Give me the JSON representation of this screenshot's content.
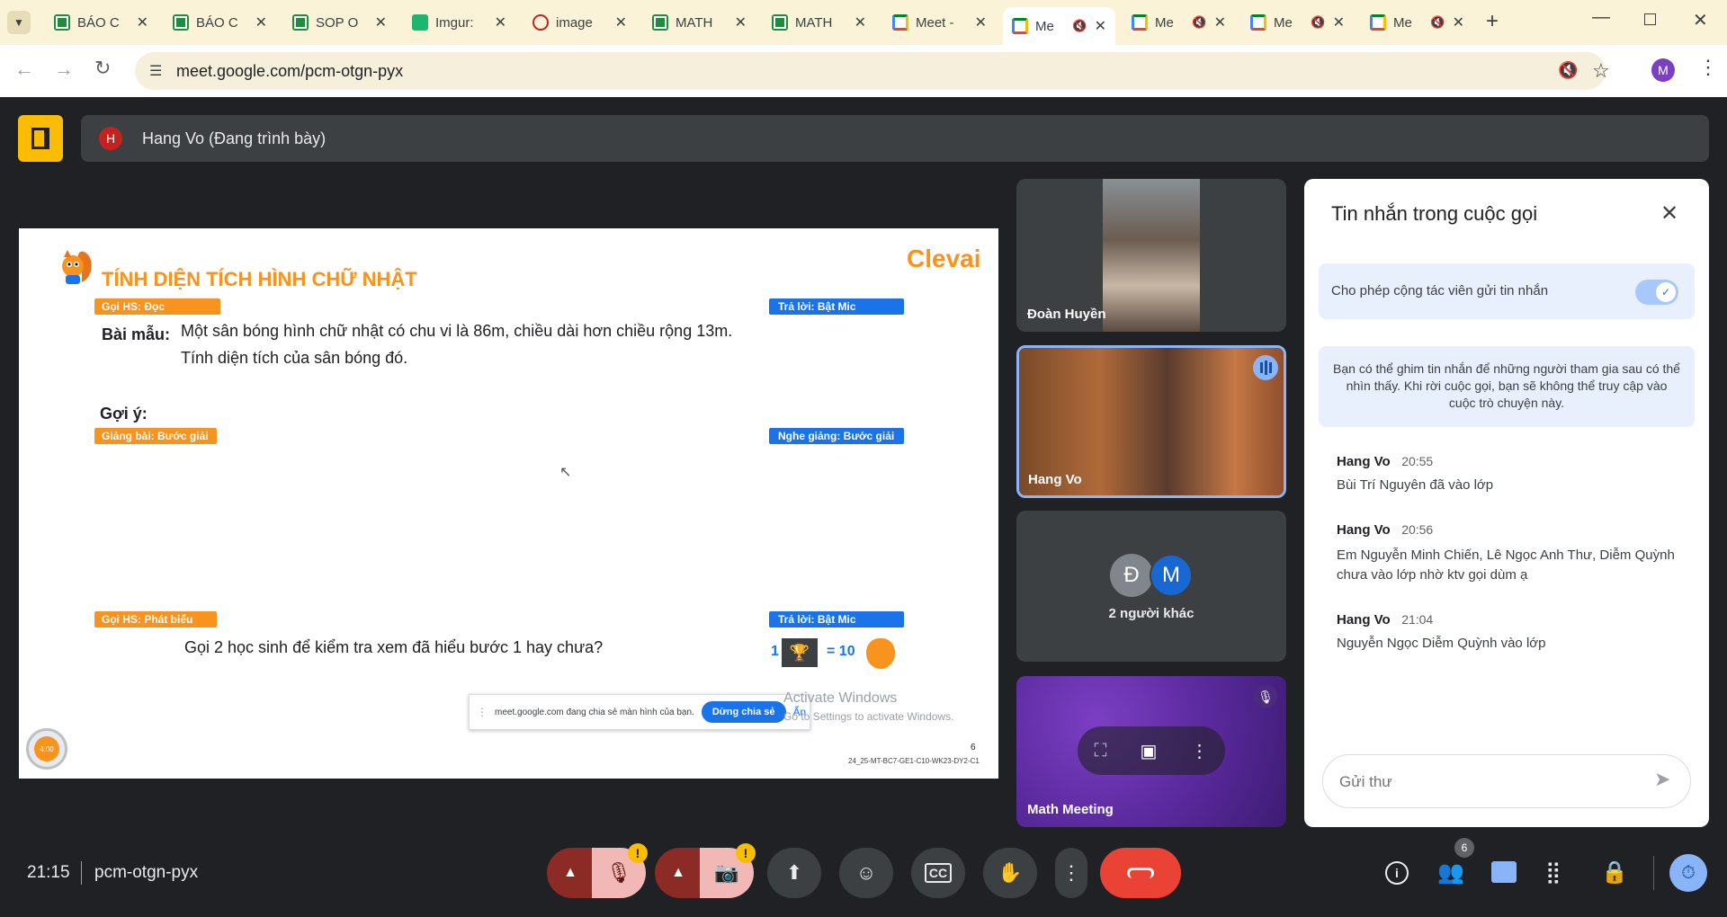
{
  "tabs": [
    {
      "title": "BÁO C",
      "icon": "sheets-icon"
    },
    {
      "title": "BÁO C",
      "icon": "sheets-icon"
    },
    {
      "title": "SOP O",
      "icon": "sheets-icon"
    },
    {
      "title": "Imgur:",
      "icon": "imgur-icon"
    },
    {
      "title": "image",
      "icon": "image-icon"
    },
    {
      "title": "MATH",
      "icon": "sheets-icon"
    },
    {
      "title": "MATH",
      "icon": "sheets-icon"
    },
    {
      "title": "Meet -",
      "icon": "meet-icon"
    },
    {
      "title": "Me",
      "icon": "meet-icon",
      "active": true
    },
    {
      "title": "Me",
      "icon": "meet-icon"
    },
    {
      "title": "Me",
      "icon": "meet-icon"
    },
    {
      "title": "Me",
      "icon": "meet-icon"
    }
  ],
  "address": {
    "url": "meet.google.com/pcm-otgn-pyx",
    "profile_initial": "M"
  },
  "presenter": {
    "initial": "H",
    "label": "Hang Vo (Đang trình bày)"
  },
  "slide": {
    "brand": "Clevai",
    "title": "TÍNH DIỆN TÍCH HÌNH CHỮ NHẬT",
    "tag1": "Gọi HS: Đọc",
    "tag2": "Trả lời: Bật Mic",
    "example_label": "Bài mẫu:",
    "example_line1": "Một sân bóng hình chữ nhật có chu vi là 86m, chiều dài hơn chiều rộng 13m.",
    "example_line2": "Tính diện tích của sân bóng đó.",
    "hint_label": "Gợi ý:",
    "tag3": "Giảng bài: Bước giải",
    "tag4": "Nghe giảng: Bước giải",
    "tag5": "Gọi HS: Phát biểu",
    "tag6": "Trả lời: Bật Mic",
    "question": "Gọi 2 học sinh để kiểm tra xem đã hiểu bước 1 hay chưa?",
    "score_num": "1",
    "score_eq": "= 10",
    "share_notice": "meet.google.com đang chia sẻ màn hình của bạn.",
    "stop_share": "Dừng chia sẻ",
    "hide": "Ẩn",
    "activate_title": "Activate Windows",
    "activate_sub": "Go to Settings to activate Windows.",
    "page_num": "6",
    "code": "24_25-MT-BC7-GE1-C10-WK23-DY2-C1",
    "timer": "4:00"
  },
  "tiles": {
    "t1_name": "Đoàn Huyền",
    "t2_name": "Hang Vo",
    "t3_av1": "Đ",
    "t3_av2": "M",
    "t3_label": "2 người khác",
    "t4_name": "Math Meeting"
  },
  "chat": {
    "title": "Tin nhắn trong cuộc gọi",
    "toggle_label": "Cho phép cộng tác viên gửi tin nhắn",
    "info": "Bạn có thể ghim tin nhắn để những người tham gia sau có thể nhìn thấy. Khi rời cuộc gọi, bạn sẽ không thể truy cập vào cuộc trò chuyện này.",
    "messages": [
      {
        "sender": "Hang Vo",
        "time": "20:55",
        "text": "Bùi Trí Nguyên đã vào lớp"
      },
      {
        "sender": "Hang Vo",
        "time": "20:56",
        "text": "Em Nguyễn Minh Chiến, Lê Ngọc Anh Thư, Diễm Quỳnh chưa vào lớp nhờ ktv gọi dùm ạ"
      },
      {
        "sender": "Hang Vo",
        "time": "21:04",
        "text": "Nguyễn Ngọc Diễm Quỳnh vào lớp"
      }
    ],
    "input_placeholder": "Gửi thư"
  },
  "bottom": {
    "time": "21:15",
    "meeting_code": "pcm-otgn-pyx",
    "people_count": "6"
  },
  "colors": {
    "accent_orange": "#f7931e",
    "tag_blue": "#1a73e8",
    "end_call": "#ea4335",
    "meet_bg": "#202124"
  }
}
